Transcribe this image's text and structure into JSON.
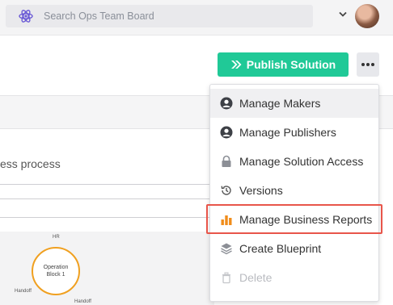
{
  "topbar": {
    "search_placeholder": "Search Ops Team Board",
    "logo_icon": "atom-logo-icon",
    "account_chevron_icon": "chevron-down-icon"
  },
  "actions": {
    "publish_label": "Publish Solution",
    "publish_icon": "double-chevron-right-icon",
    "more_icon": "ellipsis-icon"
  },
  "menu": {
    "items": [
      {
        "label": "Manage Makers",
        "icon": "user-circle-icon",
        "state": "hover"
      },
      {
        "label": "Manage Publishers",
        "icon": "user-circle-icon",
        "state": "normal"
      },
      {
        "label": "Manage Solution Access",
        "icon": "lock-icon",
        "state": "normal"
      },
      {
        "label": "Versions",
        "icon": "history-icon",
        "state": "normal"
      },
      {
        "label": "Manage Business Reports",
        "icon": "bar-chart-icon",
        "state": "highlighted"
      },
      {
        "label": "Create Blueprint",
        "icon": "layers-icon",
        "state": "normal"
      },
      {
        "label": "Delete",
        "icon": "trash-icon",
        "state": "disabled"
      }
    ]
  },
  "background": {
    "process_text": "ess process",
    "node_title": "Operation Block 1",
    "node_top_label": "HR",
    "node_left_label": "Handoff",
    "node_right_label": "Handoff"
  },
  "colors": {
    "accent_green": "#20c997",
    "report_orange": "#f08c1a",
    "focus_red": "#e8554a",
    "node_orange": "#f0a020"
  }
}
